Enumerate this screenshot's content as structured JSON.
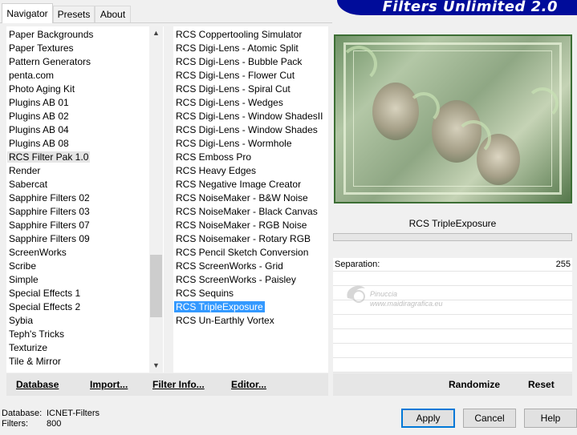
{
  "tabs": [
    "Navigator",
    "Presets",
    "About"
  ],
  "banner_title": "Filters Unlimited 2.0",
  "categories": [
    "Paper Backgrounds",
    "Paper Textures",
    "Pattern Generators",
    "penta.com",
    "Photo Aging Kit",
    "Plugins AB 01",
    "Plugins AB 02",
    "Plugins AB 04",
    "Plugins AB 08",
    "RCS Filter Pak 1.0",
    "Render",
    "Sabercat",
    "Sapphire Filters 02",
    "Sapphire Filters 03",
    "Sapphire Filters 07",
    "Sapphire Filters 09",
    "ScreenWorks",
    "Scribe",
    "Simple",
    "Special Effects 1",
    "Special Effects 2",
    "Sybia",
    "Teph's Tricks",
    "Texturize",
    "Tile & Mirror"
  ],
  "selected_category": "RCS Filter Pak 1.0",
  "filters": [
    "RCS Coppertooling Simulator",
    "RCS Digi-Lens - Atomic Split",
    "RCS Digi-Lens - Bubble Pack",
    "RCS Digi-Lens - Flower Cut",
    "RCS Digi-Lens - Spiral Cut",
    "RCS Digi-Lens - Wedges",
    "RCS Digi-Lens - Window ShadesII",
    "RCS Digi-Lens - Window Shades",
    "RCS Digi-Lens - Wormhole",
    "RCS Emboss Pro",
    "RCS Heavy Edges",
    "RCS Negative Image Creator",
    "RCS NoiseMaker - B&W Noise",
    "RCS NoiseMaker - Black Canvas",
    "RCS NoiseMaker - RGB Noise",
    "RCS Noisemaker - Rotary RGB",
    "RCS Pencil Sketch Conversion",
    "RCS ScreenWorks - Grid",
    "RCS ScreenWorks - Paisley",
    "RCS Sequins",
    "RCS TripleExposure",
    "RCS Un-Earthly Vortex"
  ],
  "selected_filter": "RCS TripleExposure",
  "current_filter_name": "RCS TripleExposure",
  "parameter": {
    "label": "Separation:",
    "value": "255"
  },
  "watermark": {
    "line1": "Pinuccia",
    "line2": "www.maidiragrafica.eu"
  },
  "bottom_links": {
    "database": "Database",
    "import": "Import...",
    "filter_info": "Filter Info...",
    "editor": "Editor...",
    "randomize": "Randomize",
    "reset": "Reset"
  },
  "status": {
    "database_label": "Database:",
    "database_value": "ICNET-Filters",
    "filters_label": "Filters:",
    "filters_value": "800"
  },
  "buttons": {
    "apply": "Apply",
    "cancel": "Cancel",
    "help": "Help"
  }
}
